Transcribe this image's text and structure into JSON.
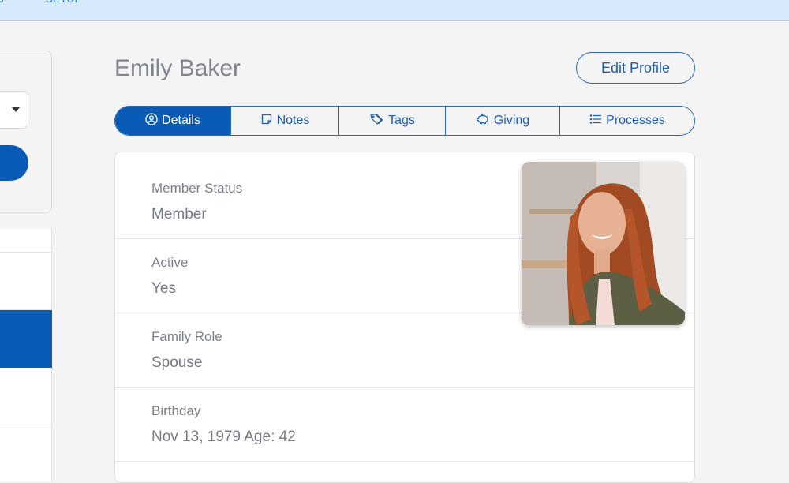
{
  "topbar": {
    "nav_items": [
      "S",
      "SETUP"
    ]
  },
  "profile": {
    "name": "Emily Baker",
    "edit_label": "Edit Profile",
    "photo_alt": "Profile photo of Emily Baker"
  },
  "tabs": [
    {
      "label": "Details",
      "icon": "user-circle-icon",
      "active": true
    },
    {
      "label": "Notes",
      "icon": "note-icon",
      "active": false
    },
    {
      "label": "Tags",
      "icon": "tags-icon",
      "active": false
    },
    {
      "label": "Giving",
      "icon": "piggy-bank-icon",
      "active": false
    },
    {
      "label": "Processes",
      "icon": "list-icon",
      "active": false
    }
  ],
  "fields": [
    {
      "label": "Member Status",
      "value": "Member"
    },
    {
      "label": "Active",
      "value": "Yes"
    },
    {
      "label": "Family Role",
      "value": "Spouse"
    },
    {
      "label": "Birthday",
      "value": "Nov 13, 1979 Age: 42"
    }
  ],
  "colors": {
    "accent": "#0a5bb5",
    "topbar": "#d6eafc",
    "background": "#f4f4f5"
  }
}
